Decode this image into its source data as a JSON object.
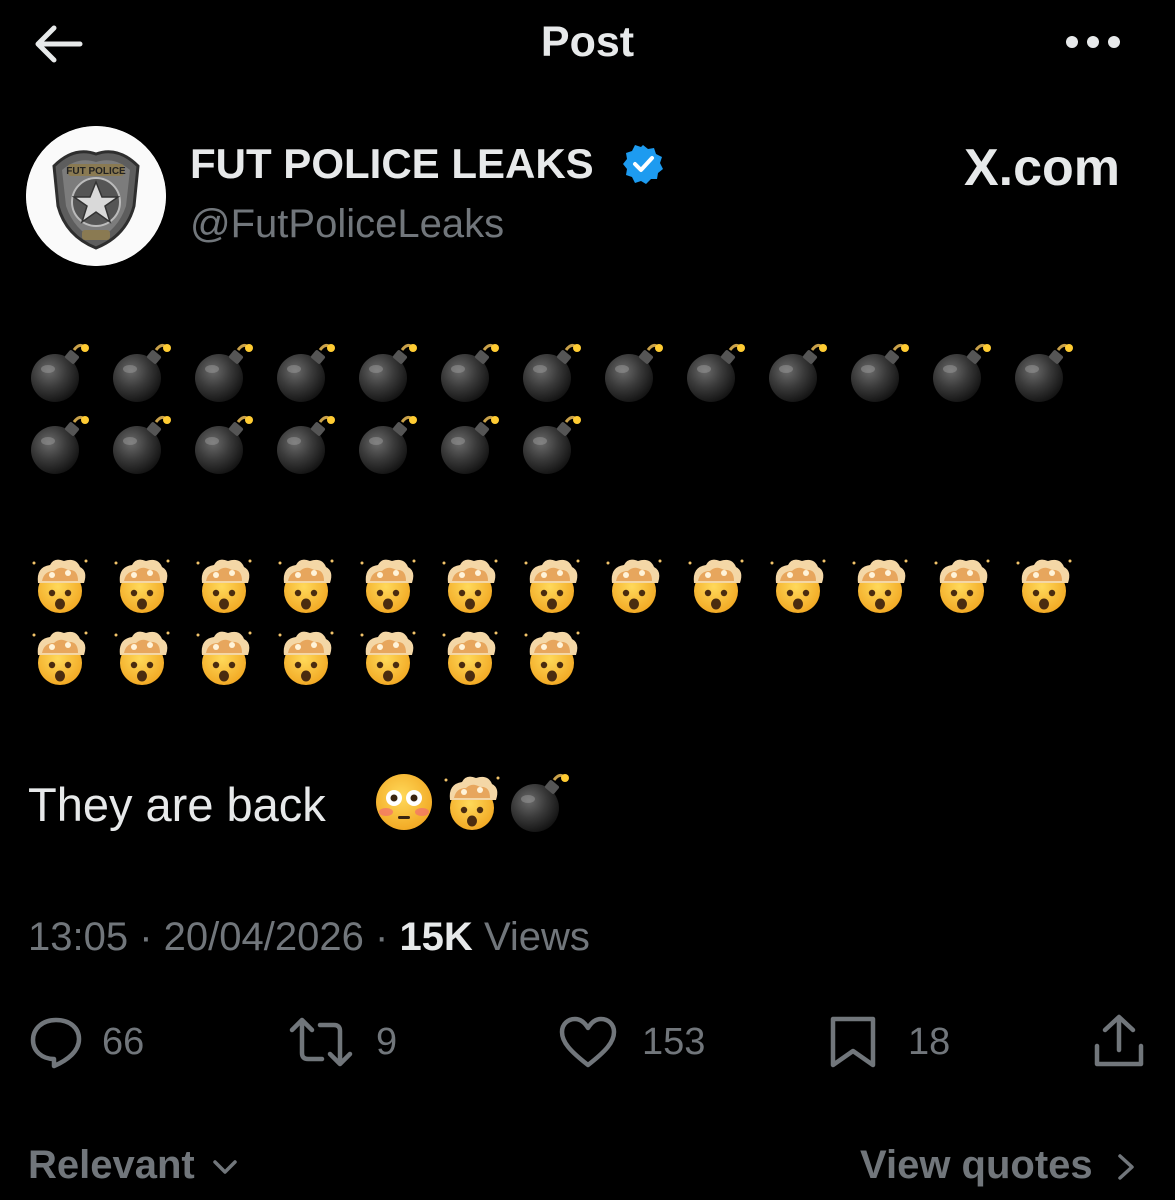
{
  "header": {
    "title": "Post"
  },
  "author": {
    "name": "FUT POLICE LEAKS",
    "handle": "@FutPoliceLeaks",
    "badge_text": "FUT POLICE"
  },
  "watermark": "X.com",
  "post": {
    "emoji_rows": [
      {
        "emoji": "bomb",
        "count": 13
      },
      {
        "emoji": "bomb",
        "count": 7
      },
      {
        "emoji": "exploding-head",
        "count": 13
      },
      {
        "emoji": "exploding-head",
        "count": 7
      }
    ],
    "text": "They are back",
    "trailing_emojis": [
      "flushed-face",
      "exploding-head",
      "bomb"
    ]
  },
  "meta": {
    "time": "13:05",
    "date": "20/04/2026",
    "views_count": "15K",
    "views_label": "Views"
  },
  "actions": {
    "replies": "66",
    "reposts": "9",
    "likes": "153",
    "bookmarks": "18"
  },
  "footer": {
    "sort_label": "Relevant",
    "view_quotes_label": "View quotes"
  },
  "colors": {
    "background": "#000000",
    "text": "#e7e9ea",
    "muted": "#71767b",
    "verified": "#1d9bf0"
  }
}
